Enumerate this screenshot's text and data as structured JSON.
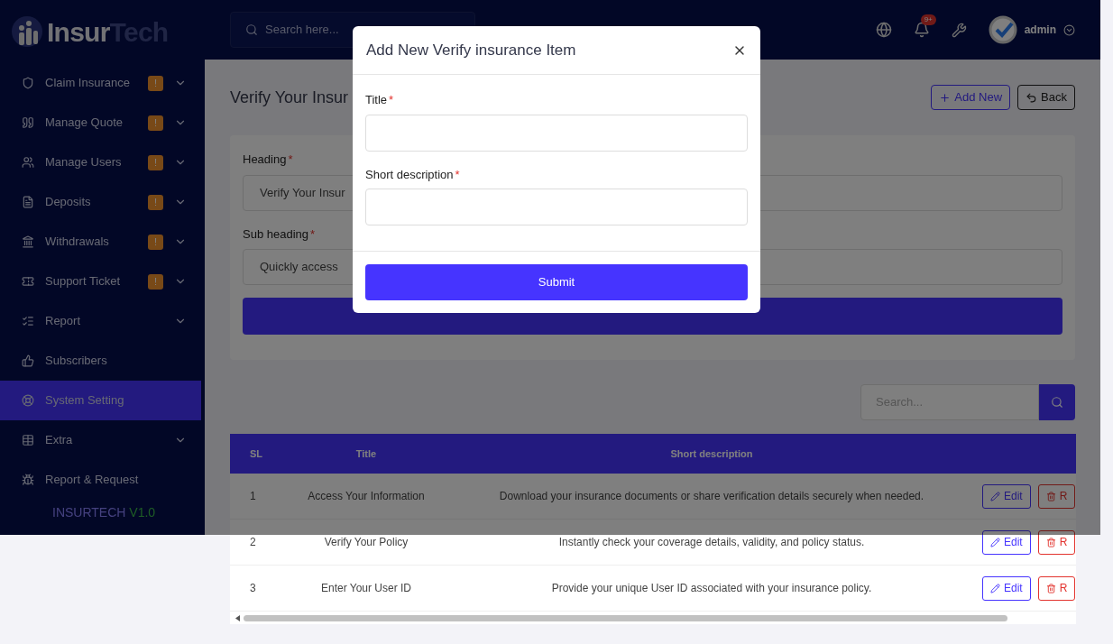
{
  "logo": {
    "part_1": "Insur",
    "part_2": "Tech"
  },
  "sidebar": {
    "items": [
      {
        "label": "Claim Insurance",
        "badge": "!",
        "expandable": true,
        "selected": false
      },
      {
        "label": "Manage Quote",
        "badge": "!",
        "expandable": true,
        "selected": false
      },
      {
        "label": "Manage Users",
        "badge": "!",
        "expandable": true,
        "selected": false
      },
      {
        "label": "Deposits",
        "badge": "!",
        "expandable": true,
        "selected": false
      },
      {
        "label": "Withdrawals",
        "badge": "!",
        "expandable": true,
        "selected": false
      },
      {
        "label": "Support Ticket",
        "badge": "!",
        "expandable": true,
        "selected": false
      },
      {
        "label": "Report",
        "expandable": true,
        "selected": false
      },
      {
        "label": "Subscribers",
        "expandable": false,
        "selected": false
      },
      {
        "label": "System Setting",
        "expandable": false,
        "selected": true
      },
      {
        "label": "Extra",
        "expandable": true,
        "selected": false
      },
      {
        "label": "Report & Request",
        "expandable": false,
        "selected": false
      }
    ],
    "footer": {
      "name": "INSURTECH",
      "version": "V1.0"
    }
  },
  "header": {
    "search": {
      "placeholder": "Search here..."
    },
    "notification_count": "9+",
    "user": "admin"
  },
  "page": {
    "title": "Verify Your Insur",
    "buttons": [
      "Add New",
      "Back"
    ]
  },
  "form": {
    "fields": [
      {
        "label": "Heading",
        "required_mark": "*",
        "value": "Verify Your Insur"
      },
      {
        "label": "Sub heading",
        "required_mark": "*",
        "value": "Quickly access"
      }
    ]
  },
  "table_search": {
    "placeholder": "Search..."
  },
  "table": {
    "columns": [
      "SL",
      "Title",
      "Short description"
    ],
    "rows": [
      {
        "sl": "1",
        "title": "Access Your Information",
        "description": "Download your insurance documents or share verification details securely when needed.",
        "actions": [
          "Edit",
          "R"
        ]
      },
      {
        "sl": "2",
        "title": "Verify Your Policy",
        "description": "Instantly check your coverage details, validity, and policy status.",
        "actions": [
          "Edit",
          "R"
        ]
      },
      {
        "sl": "3",
        "title": "Enter Your User ID",
        "description": "Provide your unique User ID associated with your insurance policy.",
        "actions": [
          "Edit",
          "R"
        ]
      }
    ]
  },
  "modal": {
    "title": "Add New Verify insurance Item",
    "fields": [
      {
        "label": "Title",
        "required_mark": "*"
      },
      {
        "label": "Short description",
        "required_mark": "*"
      }
    ],
    "submit": "Submit"
  }
}
